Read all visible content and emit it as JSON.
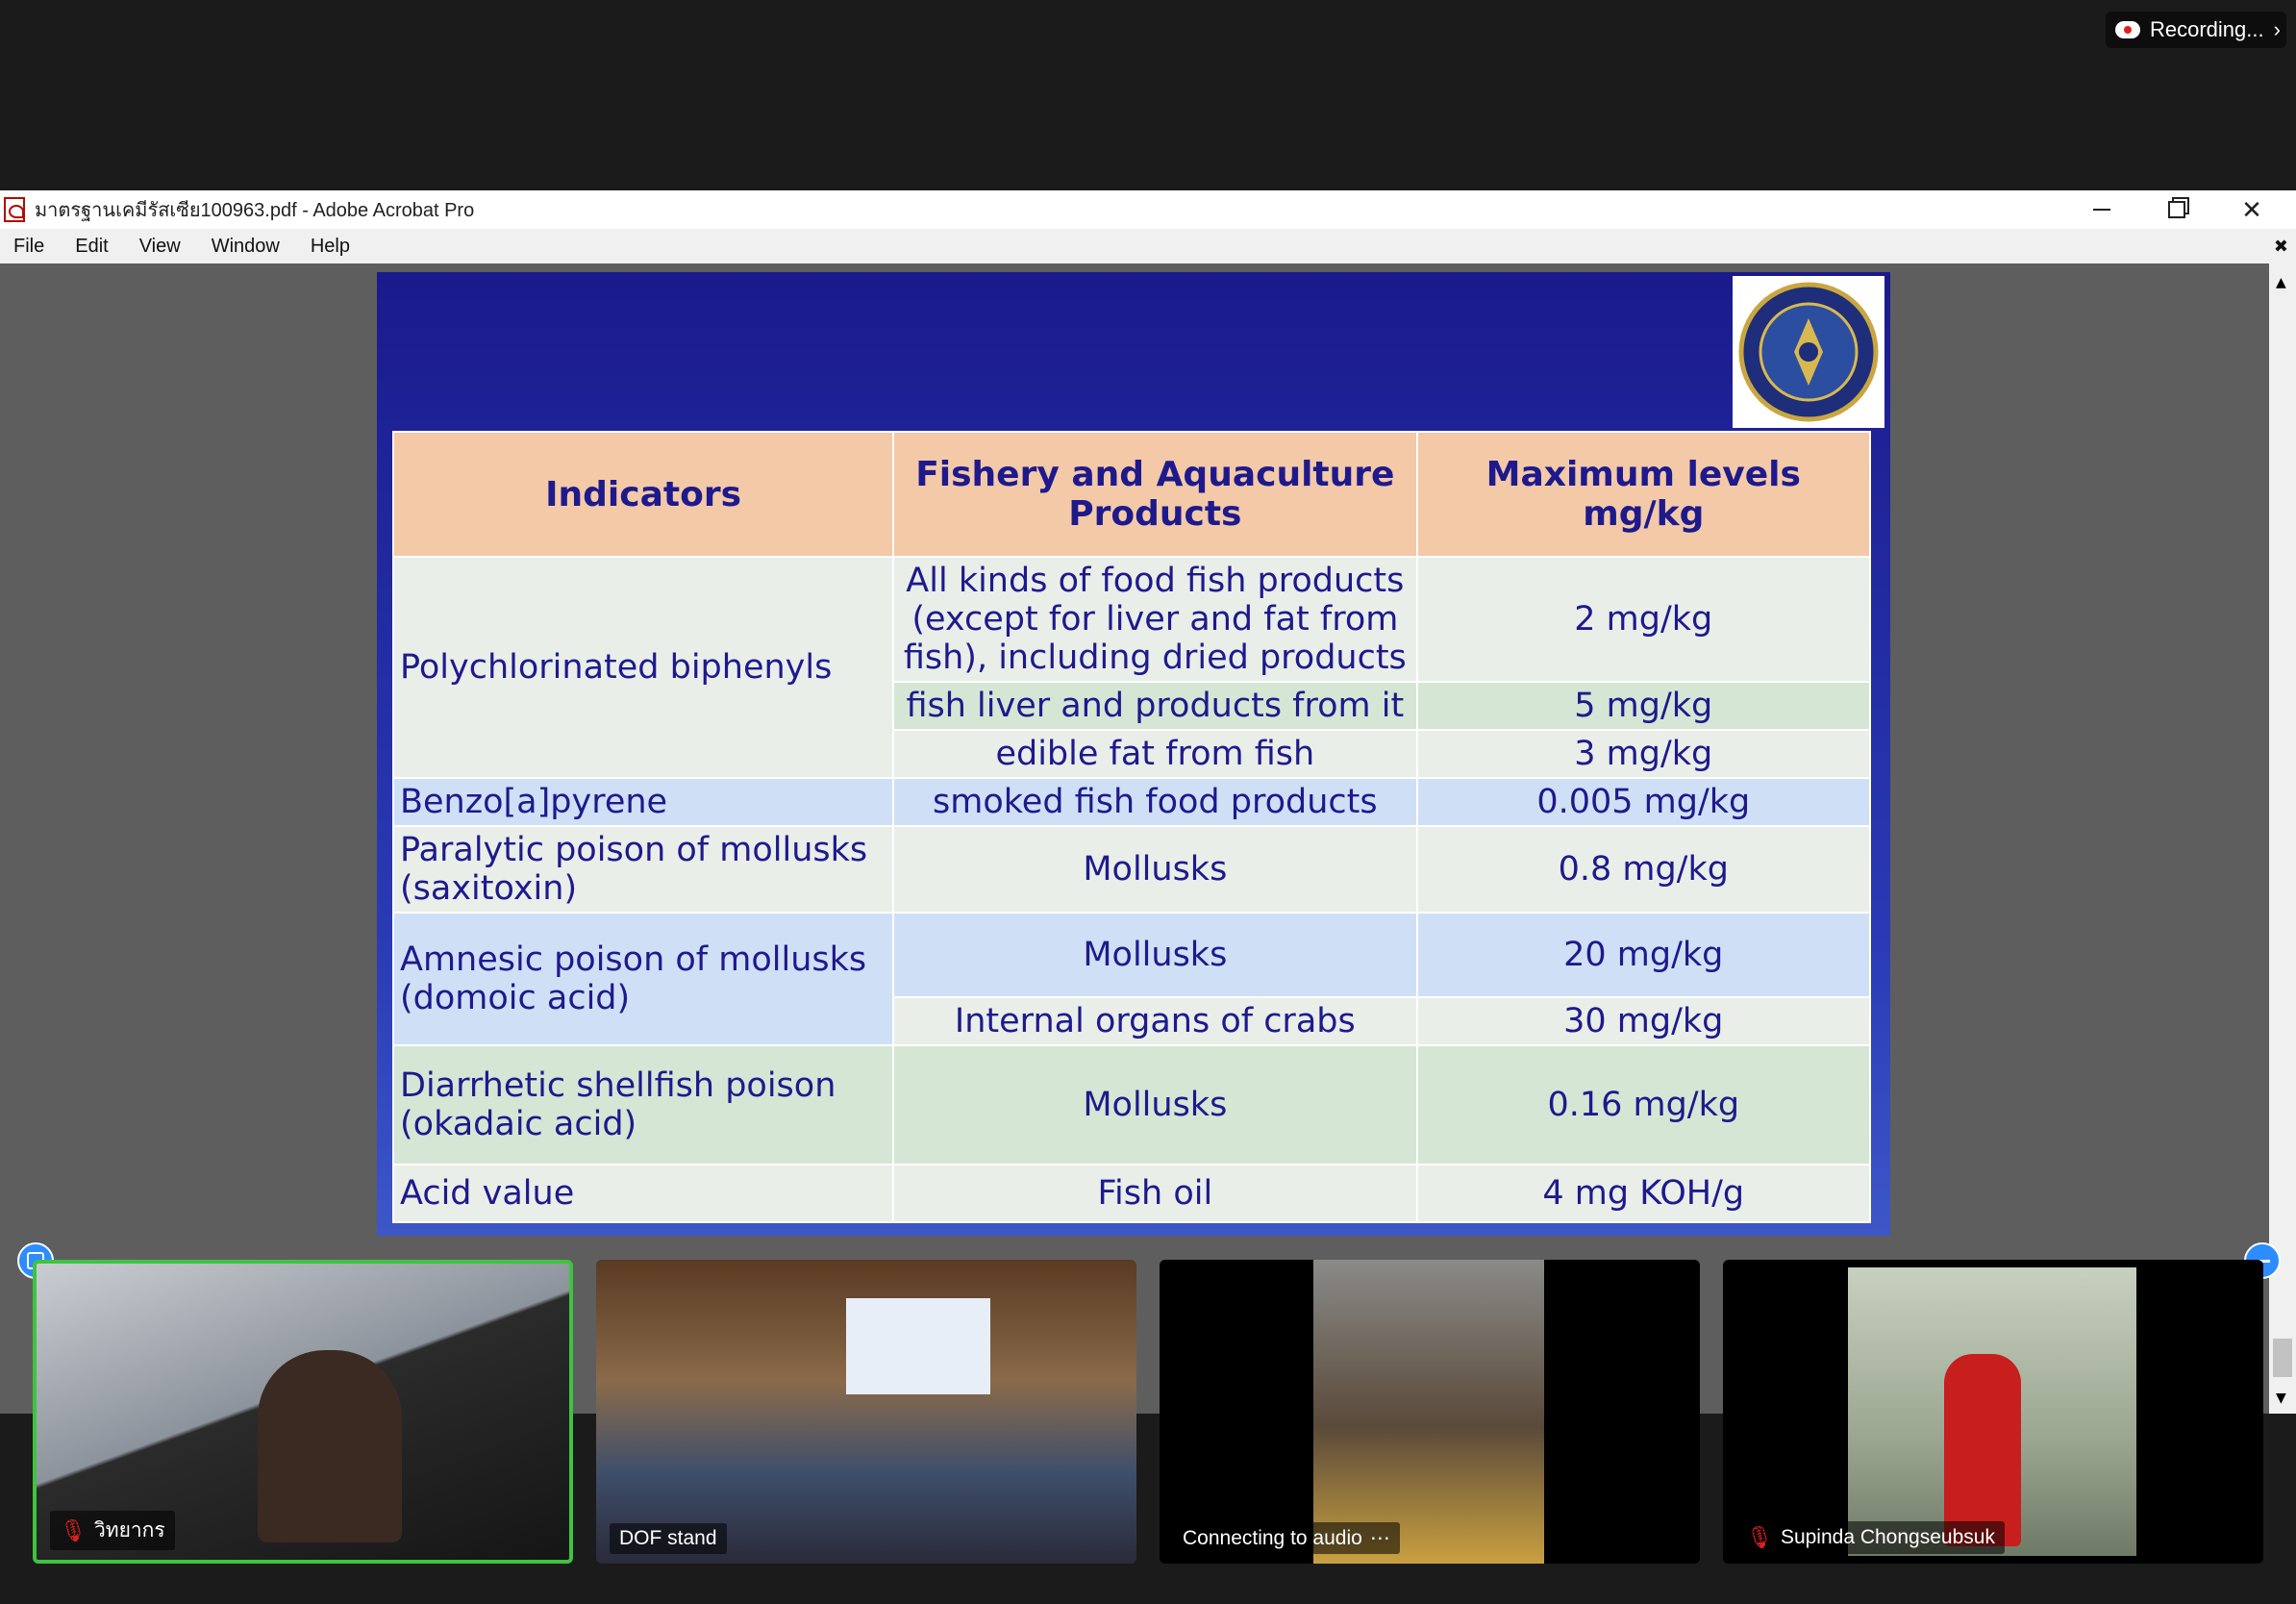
{
  "zoom": {
    "recording_label": "Recording...",
    "recording_icon": "cloud-record-icon"
  },
  "acrobat": {
    "title": "มาตรฐานเคมีรัสเซีย100963.pdf - Adobe Acrobat Pro",
    "menu": [
      "File",
      "Edit",
      "View",
      "Window",
      "Help"
    ],
    "close_doc": "✖"
  },
  "slide": {
    "table": {
      "headers": [
        "Indicators",
        "Fishery and Aquaculture Products",
        "Maximum levels mg/kg"
      ],
      "rows": [
        {
          "indicator": "Polychlorinated biphenyls",
          "product": "All kinds of food fish products (except for liver and fat from fish), including dried products",
          "level": "2 mg/kg"
        },
        {
          "indicator": "",
          "product": "fish liver and products from it",
          "level": "5 mg/kg"
        },
        {
          "indicator": "",
          "product": "edible fat from fish",
          "level": "3 mg/kg"
        },
        {
          "indicator": "Benzo[a]pyrene",
          "product": "smoked fish food products",
          "level": "0.005 mg/kg"
        },
        {
          "indicator": "Paralytic poison of mollusks (saxitoxin)",
          "product": "Mollusks",
          "level": "0.8 mg/kg"
        },
        {
          "indicator": "Amnesic poison of mollusks (domoic acid)",
          "product": "Mollusks",
          "level": "20 mg/kg"
        },
        {
          "indicator": "",
          "product": "Internal organs of crabs",
          "level": "30 mg/kg"
        },
        {
          "indicator": "Diarrhetic shellfish poison (okadaic acid)",
          "product": "Mollusks",
          "level": "0.16 mg/kg"
        },
        {
          "indicator": "Acid value",
          "product": "Fish oil",
          "level": "4 mg KOH/g"
        }
      ]
    }
  },
  "participants": [
    {
      "name": "วิทยากร",
      "muted": true
    },
    {
      "name": "DOF stand",
      "muted": false
    },
    {
      "name": "Connecting to audio",
      "muted": false
    },
    {
      "name": "Supinda Chongseubsuk",
      "muted": true
    }
  ]
}
